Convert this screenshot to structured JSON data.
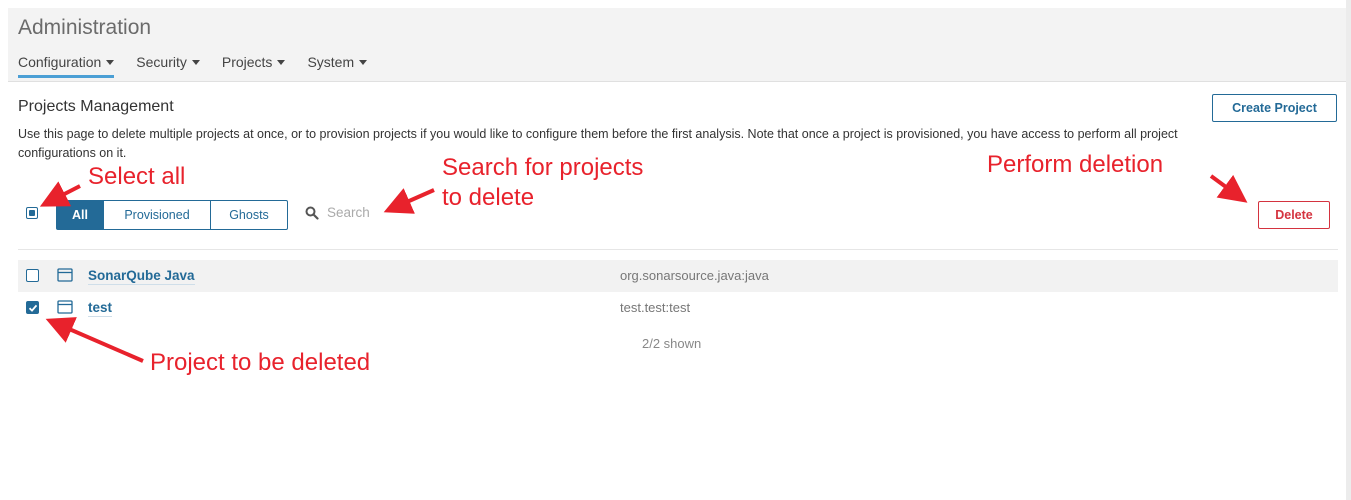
{
  "header": {
    "title": "Administration",
    "nav": [
      {
        "label": "Configuration",
        "active": true
      },
      {
        "label": "Security",
        "active": false
      },
      {
        "label": "Projects",
        "active": false
      },
      {
        "label": "System",
        "active": false
      }
    ]
  },
  "page": {
    "title": "Projects Management",
    "description": "Use this page to delete multiple projects at once, or to provision projects if you would like to configure them before the first analysis. Note that once a project is provisioned, you have access to perform all project configurations on it.",
    "create_button": "Create Project",
    "delete_button": "Delete"
  },
  "filters": {
    "options": [
      "All",
      "Provisioned",
      "Ghosts"
    ],
    "selected": "All"
  },
  "search": {
    "placeholder": "Search",
    "value": ""
  },
  "projects": [
    {
      "name": "SonarQube Java",
      "key": "org.sonarsource.java:java",
      "checked": false
    },
    {
      "name": "test",
      "key": "test.test:test",
      "checked": true
    }
  ],
  "footer": {
    "shown": "2/2 shown"
  },
  "annotations": {
    "select_all": "Select all",
    "search_line1": "Search for projects",
    "search_line2": "to delete",
    "perform": "Perform deletion",
    "project": "Project to be deleted"
  },
  "colors": {
    "accent": "#236a97",
    "danger": "#d4333f",
    "annotation": "#e8222c"
  },
  "icons": {
    "search": "search-icon",
    "qualifier": "project-qualifier-icon",
    "caret": "caret-down-icon",
    "checkmark": "checkmark-icon"
  }
}
